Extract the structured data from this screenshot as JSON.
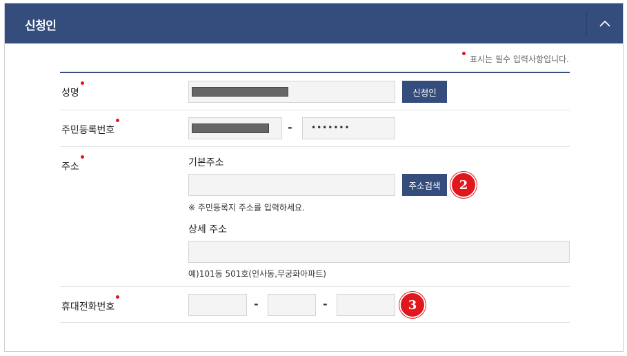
{
  "panel": {
    "title": "신청인",
    "collapse_icon": "chevron-up-icon"
  },
  "required_note": "표시는 필수 입력사항입니다.",
  "colors": {
    "header": "#354d7c",
    "required": "#e0171d",
    "button": "#354d7c"
  },
  "fields": {
    "name": {
      "label": "성명",
      "button": "신청인"
    },
    "rrn": {
      "label": "주민등록번호",
      "separator": "-",
      "back_value": "•••••••"
    },
    "address": {
      "label": "주소",
      "basic_label": "기본주소",
      "search_button": "주소검색",
      "basic_hint": "※ 주민등록지 주소를 입력하세요.",
      "detail_label": "상세 주소",
      "detail_hint": "예)101동 501호(인사동,무궁화아파트)"
    },
    "phone": {
      "label": "휴대전화번호",
      "separator1": "-",
      "separator2": "-"
    }
  },
  "badges": {
    "search": "2",
    "phone": "3"
  }
}
